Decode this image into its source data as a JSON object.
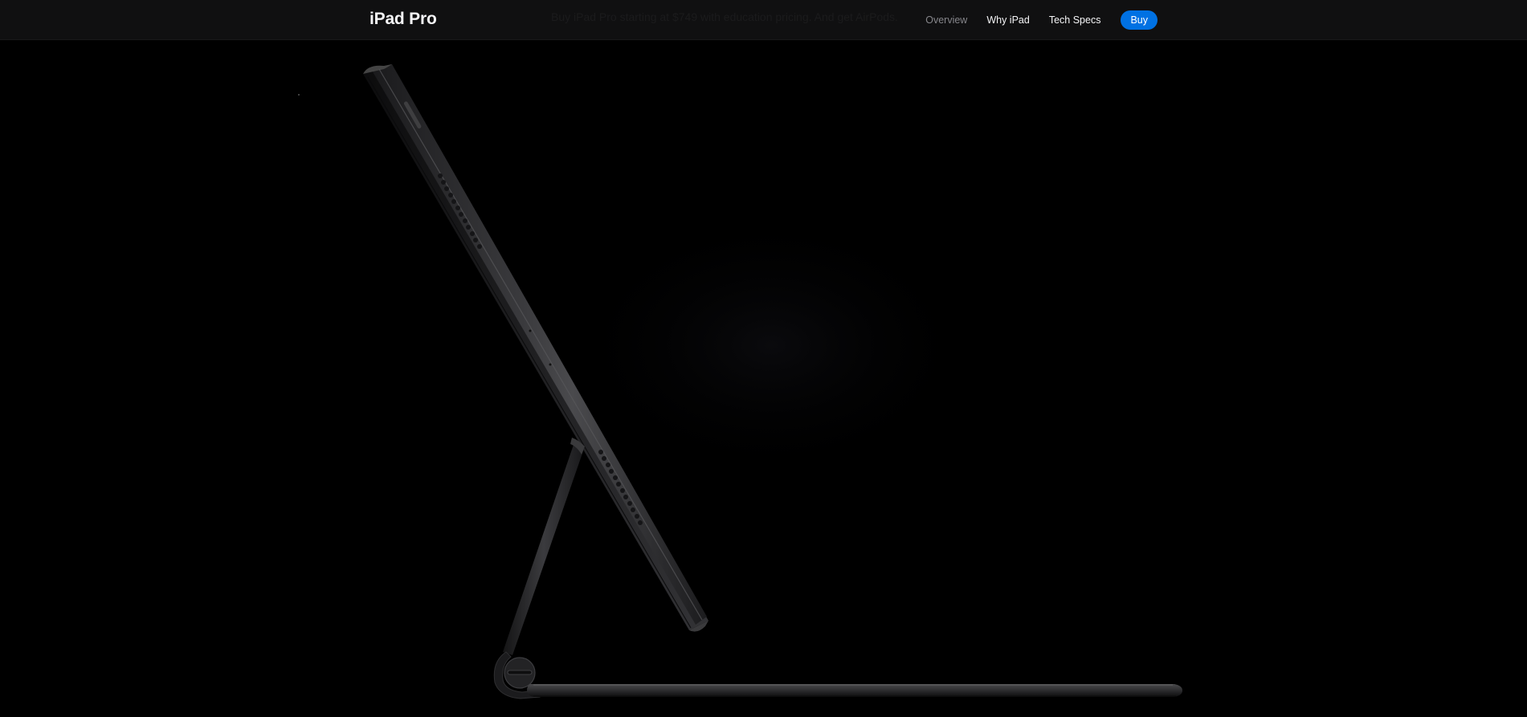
{
  "localnav": {
    "product_title": "iPad Pro",
    "ribbon_text": "Buy iPad Pro starting at $749 with education pricing. And get AirPods.",
    "links": [
      {
        "label": "Overview",
        "current": true
      },
      {
        "label": "Why iPad",
        "current": false
      },
      {
        "label": "Tech Specs",
        "current": false
      }
    ],
    "buy_label": "Buy"
  },
  "colors": {
    "background": "#000000",
    "nav_background": "#161617",
    "accent": "#0071e3",
    "device_body": "#2b2b2d"
  },
  "hero": {
    "image": "ipad-pro-side-view-on-magic-keyboard"
  }
}
